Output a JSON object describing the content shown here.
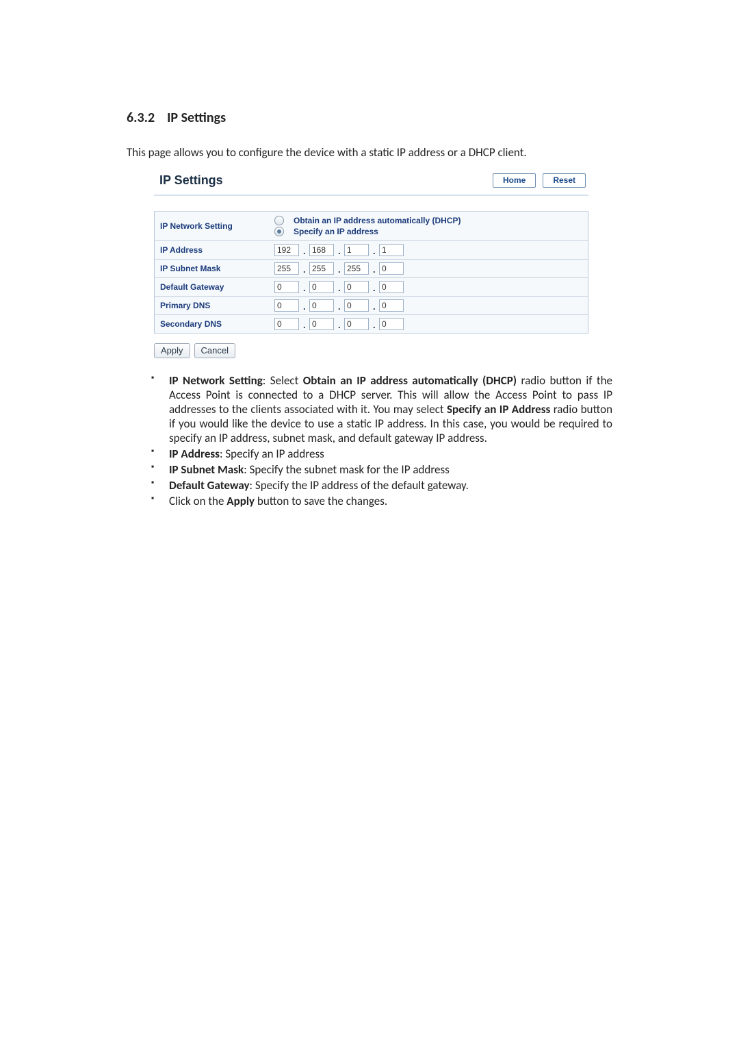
{
  "section": {
    "number": "6.3.2",
    "title": "IP Settings"
  },
  "intro": "This page allows you to configure the device with a static IP address or a DHCP client.",
  "panel": {
    "title": "IP Settings",
    "home_btn": "Home",
    "reset_btn": "Reset",
    "rows": {
      "network_setting": {
        "label": "IP Network Setting",
        "opt_dhcp": "Obtain an IP address automatically (DHCP)",
        "opt_static": "Specify an IP address",
        "selected": "static"
      },
      "ip_address": {
        "label": "IP Address",
        "o1": "192",
        "o2": "168",
        "o3": "1",
        "o4": "1"
      },
      "subnet_mask": {
        "label": "IP Subnet Mask",
        "o1": "255",
        "o2": "255",
        "o3": "255",
        "o4": "0"
      },
      "default_gw": {
        "label": "Default Gateway",
        "o1": "0",
        "o2": "0",
        "o3": "0",
        "o4": "0"
      },
      "primary_dns": {
        "label": "Primary DNS",
        "o1": "0",
        "o2": "0",
        "o3": "0",
        "o4": "0"
      },
      "secondary_dns": {
        "label": "Secondary DNS",
        "o1": "0",
        "o2": "0",
        "o3": "0",
        "o4": "0"
      }
    },
    "apply_btn": "Apply",
    "cancel_btn": "Cancel"
  },
  "bullets": {
    "b1_lead": "IP Network Setting",
    "b1_text1": ": Select ",
    "b1_bold1": "Obtain an IP address automatically (DHCP)",
    "b1_text2": " radio button if the Access Point is connected to a DHCP server. This will allow the Access Point to pass IP addresses to the clients associated with it. You may select ",
    "b1_bold2": "Specify an IP Address",
    "b1_text3": " radio button if you would like the device to use a static IP address. In this case, you would be required to specify an IP address, subnet mask, and default gateway IP address.",
    "b2_lead": "IP Address",
    "b2_text": ": Specify an IP address",
    "b3_lead": "IP Subnet Mask",
    "b3_text": ": Specify the subnet mask for the IP address",
    "b4_lead": "Default Gateway",
    "b4_text": ": Specify the IP address of the default gateway.",
    "b5_text1": "Click on the ",
    "b5_bold": "Apply",
    "b5_text2": " button to save the changes."
  }
}
